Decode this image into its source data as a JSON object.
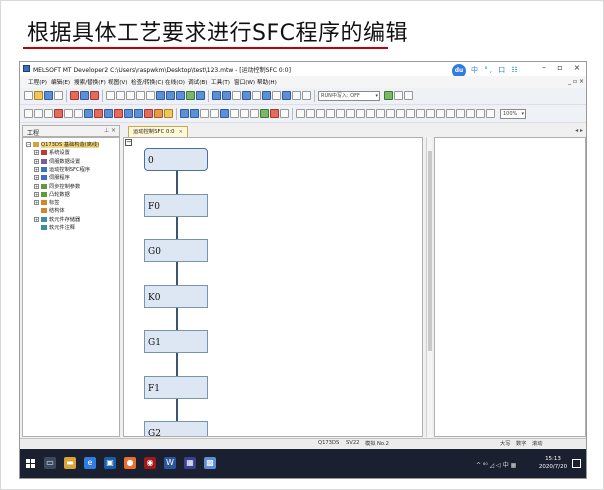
{
  "slide": {
    "title": "根据具体工艺要求进行SFC程序的编辑"
  },
  "window": {
    "title": "MELSOFT MT Developer2 C:\\Users\\raspwkm\\Desktop\\test\\123.mtw - [运动控制SFC 0:0]",
    "controls": [
      "–",
      "▫",
      "×"
    ],
    "mdi_controls": "_ ▫ ×",
    "baidu_label": "du",
    "tray_icons": "中 °, 口 ☷"
  },
  "menu": [
    "工程(P)",
    "编辑(E)",
    "搜索/替换(F)",
    "视图(V)",
    "检查/转换(C)",
    "在线(O)",
    "调试(B)",
    "工具(T)",
    "窗口(W)",
    "帮助(H)"
  ],
  "toolbar": {
    "run_mode": "RUN中写入: OFF",
    "zoom": "100%"
  },
  "project_pane": {
    "header": "工程",
    "pin": "⊥ ×",
    "items": [
      {
        "label": "Q173DS 基础构造(离线)",
        "level": 0,
        "exp": "−",
        "color": "#d9a23a"
      },
      {
        "label": "系统设置",
        "level": 1,
        "exp": "+",
        "color": "#c2372f"
      },
      {
        "label": "伺服数据设置",
        "level": 1,
        "exp": "+",
        "color": "#7a5b9e"
      },
      {
        "label": "运动控制SFC程序",
        "level": 1,
        "exp": "+",
        "color": "#3b73c2"
      },
      {
        "label": "伺服程序",
        "level": 1,
        "exp": "+",
        "color": "#3b73c2"
      },
      {
        "label": "同步控制参数",
        "level": 1,
        "exp": "+",
        "color": "#5f9a3e"
      },
      {
        "label": "凸轮数据",
        "level": 1,
        "exp": "+",
        "color": "#5f9a3e"
      },
      {
        "label": "标签",
        "level": 1,
        "exp": "+",
        "color": "#d1882c"
      },
      {
        "label": "结构体",
        "level": 1,
        "exp": "",
        "color": "#d1882c"
      },
      {
        "label": "软元件存储器",
        "level": 1,
        "exp": "+",
        "color": "#3a8fa6"
      },
      {
        "label": "软元件注释",
        "level": 1,
        "exp": "",
        "color": "#3a8fa6"
      }
    ]
  },
  "doc_tab": {
    "label": "运动控制SFC 0:0",
    "close": "×",
    "nav": "◂ ▸"
  },
  "sfc": {
    "collapse": "−",
    "steps": [
      "0",
      "F0",
      "G0",
      "K0",
      "G1",
      "F1",
      "G2"
    ]
  },
  "statusbar": {
    "cpu": "Q173DS",
    "version": "SV22",
    "sim": "模拟 No.2",
    "caps": "大写",
    "num": "数字",
    "scroll": "滚动"
  },
  "taskbar": {
    "tray": "^ ⁸⁰ ◿ ◁ 中 ▦",
    "time": "15:13",
    "date": "2020/7/20"
  }
}
